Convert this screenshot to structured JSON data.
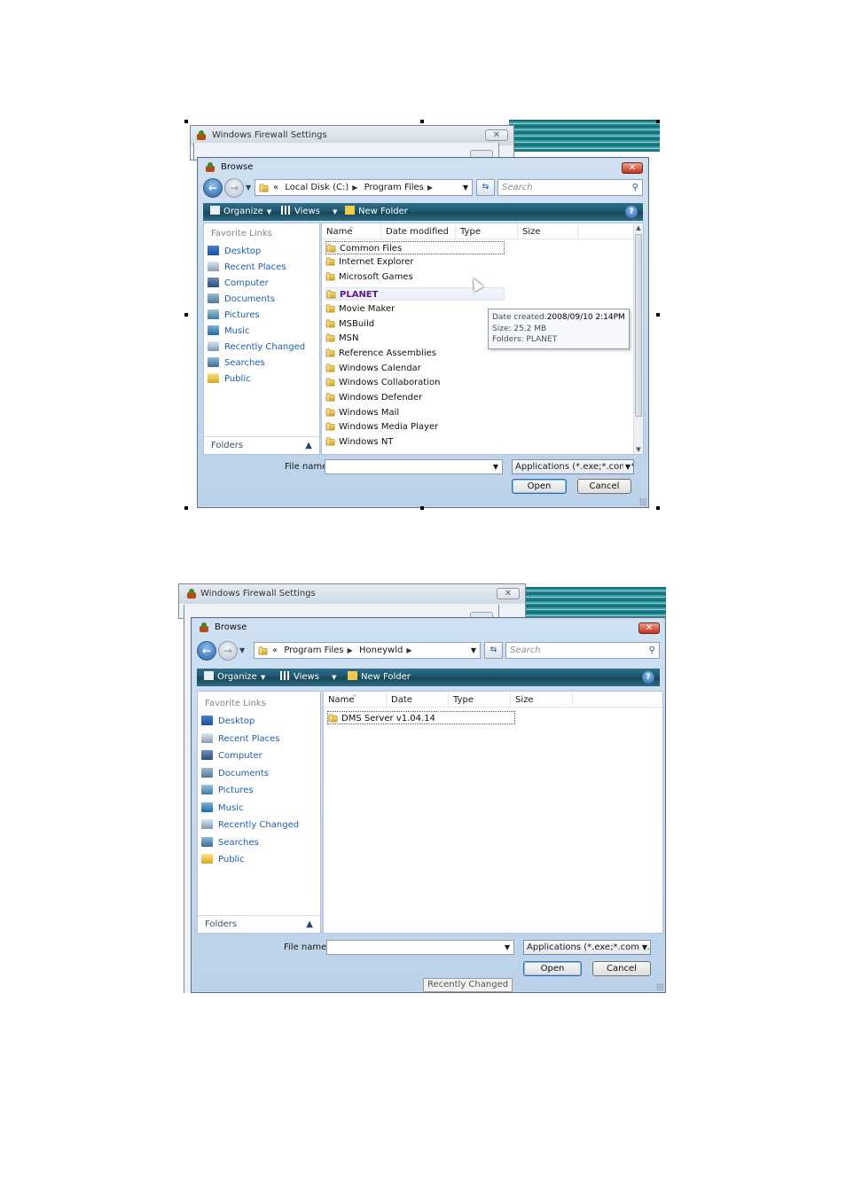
{
  "parent_window": {
    "title": "Windows Firewall Settings",
    "close_glyph": "✕"
  },
  "screens": [
    {
      "browse_title": "Browse",
      "close_glyph": "✕",
      "address": {
        "prefix": "«",
        "crumbs": [
          "Local Disk (C:)",
          "Program Files"
        ]
      },
      "search_placeholder": "Search",
      "toolbar": {
        "organize": "Organize",
        "views": "Views",
        "new_folder": "New Folder",
        "help": "?"
      },
      "nav": {
        "section_title": "Favorite Links",
        "items": [
          {
            "label": "Desktop",
            "icon": "desktop-icon"
          },
          {
            "label": "Recent Places",
            "icon": "recent-places-icon"
          },
          {
            "label": "Computer",
            "icon": "computer-icon"
          },
          {
            "label": "Documents",
            "icon": "documents-icon"
          },
          {
            "label": "Pictures",
            "icon": "pictures-icon"
          },
          {
            "label": "Music",
            "icon": "music-icon"
          },
          {
            "label": "Recently Changed",
            "icon": "recently-changed-icon"
          },
          {
            "label": "Searches",
            "icon": "searches-icon"
          },
          {
            "label": "Public",
            "icon": "public-icon"
          }
        ],
        "folders_label": "Folders"
      },
      "columns": [
        "Name",
        "Date modified",
        "Type",
        "Size"
      ],
      "files": [
        "Common Files",
        "Internet Explorer",
        "Microsoft Games",
        "PLANET",
        "Movie Maker",
        "MSBuild",
        "MSN",
        "Reference Assemblies",
        "Windows Calendar",
        "Windows Collaboration",
        "Windows Defender",
        "Windows Mail",
        "Windows Media Player",
        "Windows NT"
      ],
      "tooltip": {
        "line1_label": "Date created:",
        "line1_value": "2008/09/10  2:14PM",
        "line2": "Size: 25.2 MB",
        "line3_label": "Folders: ",
        "line3_value": "PLANET"
      },
      "file_name_label": "File name:",
      "file_name_value": "",
      "file_type": "Applications (*.exe;*.com;*.icc",
      "open_button": "Open",
      "cancel_button": "Cancel"
    },
    {
      "browse_title": "Browse",
      "close_glyph": "✕",
      "address": {
        "prefix": "«",
        "crumbs": [
          "Program Files",
          "Honeywld"
        ]
      },
      "search_placeholder": "Search",
      "toolbar": {
        "organize": "Organize",
        "views": "Views",
        "new_folder": "New Folder",
        "help": "?"
      },
      "nav": {
        "section_title": "Favorite Links",
        "items": [
          {
            "label": "Desktop",
            "icon": "desktop-icon"
          },
          {
            "label": "Recent Places",
            "icon": "recent-places-icon"
          },
          {
            "label": "Computer",
            "icon": "computer-icon"
          },
          {
            "label": "Documents",
            "icon": "documents-icon"
          },
          {
            "label": "Pictures",
            "icon": "pictures-icon"
          },
          {
            "label": "Music",
            "icon": "music-icon"
          },
          {
            "label": "Recently Changed",
            "icon": "recently-changed-icon"
          },
          {
            "label": "Searches",
            "icon": "searches-icon"
          },
          {
            "label": "Public",
            "icon": "public-icon"
          }
        ],
        "folders_label": "Folders"
      },
      "columns": [
        "Name",
        "Date modif...",
        "Type",
        "Size"
      ],
      "files": [
        "DMS Server v1.04.14"
      ],
      "file_name_label": "File name:",
      "file_name_value": "",
      "file_type": "Applications (*.exe;*.com;*.icc",
      "open_button": "Open",
      "cancel_button": "Cancel",
      "hover_tooltip": "Recently Changed"
    }
  ],
  "colors": {
    "accent": "#1d5ea8",
    "toolbar": "#1c536b",
    "close_red": "#c2331c",
    "selected_folder": "#5a1a8c"
  }
}
